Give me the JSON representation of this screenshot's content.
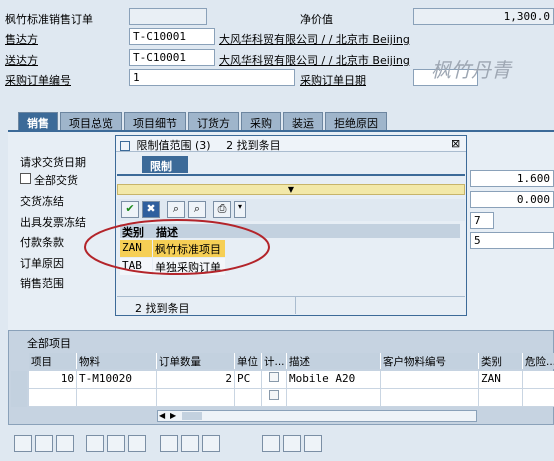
{
  "header": {
    "order_type_label": "枫竹标准销售订单",
    "net_value_label": "净价值",
    "net_value": "1,300.0",
    "sold_to_label": "售达方",
    "sold_to_value": "T-C10001",
    "sold_to_desc": "大风华科贸有限公司 / / 北京市 Beijing",
    "ship_to_label": "送达方",
    "ship_to_value": "T-C10001",
    "ship_to_desc": "大风华科贸有限公司 / / 北京市 Beijing",
    "po_label": "采购订单编号",
    "po_value": "1",
    "po_date_label": "采购订单日期"
  },
  "watermark": "枫竹丹青",
  "tabs": [
    "销售",
    "项目总览",
    "项目细节",
    "订货方",
    "采购",
    "装运",
    "拒绝原因"
  ],
  "sales_fields": {
    "req_delivery_label": "请求交货日期",
    "complete_delivery_label": "全部交货",
    "delivery_block_label": "交货冻结",
    "billing_block_label": "出具发票冻结",
    "payment_terms_label": "付款条款",
    "order_reason_label": "订单原因",
    "sales_area_label": "销售范围",
    "right_value_1": "1.600",
    "right_value_2": "0.000",
    "right_value_3": "7",
    "right_value_4": "5"
  },
  "popup": {
    "title": "限制值范围 (3)",
    "found_title": "2 找到条目",
    "close_glyph": "⊠",
    "tab_label": "限制",
    "col_type": "类别",
    "col_desc": "描述",
    "rows": [
      {
        "code": "ZAN",
        "desc": "枫竹标准项目"
      },
      {
        "code": "TAB",
        "desc": "单独采购订单"
      }
    ],
    "status": "2 找到条目"
  },
  "items_table": {
    "title": "全部项目",
    "headers": [
      "项目",
      "物料",
      "订单数量",
      "单位",
      "计...",
      "描述",
      "客户物料编号",
      "类别",
      "危险..."
    ],
    "row": {
      "item": "10",
      "material": "T-M10020",
      "qty": "2",
      "unit": "PC",
      "desc": "Mobile A20",
      "category": "ZAN"
    }
  },
  "colors": {
    "background": "#dfe8f1",
    "tab_active": "#3c6a98",
    "highlight_row": "#f6cf55",
    "annotation_red": "#b3242a"
  }
}
